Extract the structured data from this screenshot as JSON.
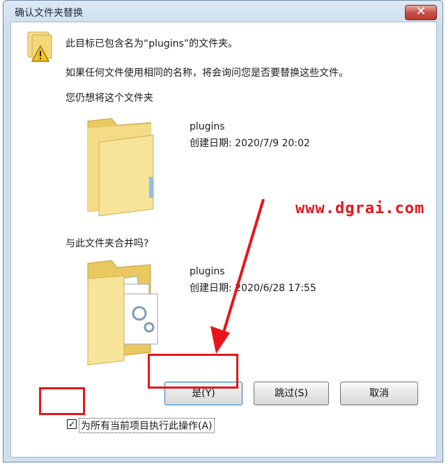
{
  "window": {
    "title": "确认文件夹替换",
    "close_label": "✕"
  },
  "message": {
    "line1": "此目标已包含名为“plugins”的文件夹。",
    "line2": "如果任何文件使用相同的名称，将会询问您是否要替换这些文件。",
    "line3": "您仍想将这个文件夹",
    "merge_question": "与此文件夹合并吗?"
  },
  "target_folder": {
    "name": "plugins",
    "created": "创建日期: 2020/7/9 20:02"
  },
  "source_folder": {
    "name": "plugins",
    "created": "创建日期: 2020/6/28 17:55"
  },
  "buttons": {
    "yes": "是(Y)",
    "skip": "跳过(S)",
    "cancel": "取消"
  },
  "apply_all": {
    "label": "为所有当前项目执行此操作(A)",
    "checked": true,
    "mark": "✓"
  },
  "watermark": "www.dgrai.com",
  "colors": {
    "annotation_red": "#e8141a",
    "folder_yellow": "#f2d77a"
  }
}
